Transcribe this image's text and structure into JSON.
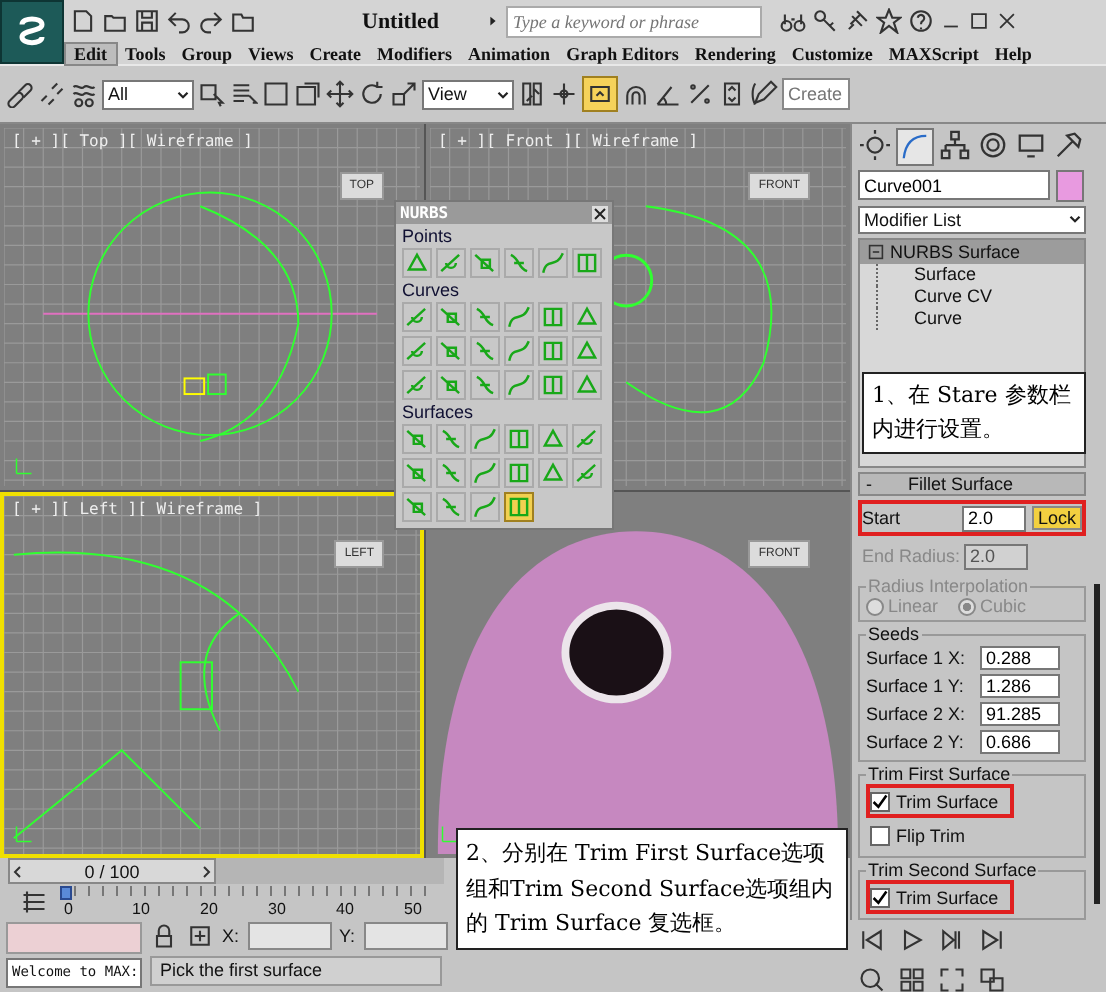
{
  "title_bar": {
    "title": "Untitled",
    "search": {
      "placeholder": "Type a keyword or phrase"
    }
  },
  "menu": [
    {
      "label": "Edit",
      "selected": true
    },
    {
      "label": "Tools",
      "selected": false
    },
    {
      "label": "Group",
      "selected": false
    },
    {
      "label": "Views",
      "selected": false
    },
    {
      "label": "Create",
      "selected": false
    },
    {
      "label": "Modifiers",
      "selected": false
    },
    {
      "label": "Animation",
      "selected": false
    },
    {
      "label": "Graph Editors",
      "selected": false
    },
    {
      "label": "Rendering",
      "selected": false
    },
    {
      "label": "Customize",
      "selected": false
    },
    {
      "label": "MAXScript",
      "selected": false
    },
    {
      "label": "Help",
      "selected": false
    }
  ],
  "toolbar": {
    "selection_filter": "All",
    "reference_coord": "View",
    "named_selection": {
      "placeholder": "Create"
    }
  },
  "viewports": [
    {
      "kind": "top",
      "label": "[ + ][ Top ][ Wireframe ]",
      "cube_label": "TOP",
      "active": false
    },
    {
      "kind": "front",
      "label": "[ + ][ Front ][ Wireframe ]",
      "cube_label": "FRONT",
      "active": false
    },
    {
      "kind": "left",
      "label": "[ + ][ Left ][ Wireframe ]",
      "cube_label": "LEFT",
      "active": true
    },
    {
      "kind": "perspective",
      "cube_label": "FRONT",
      "active": false
    }
  ],
  "nurbs_toolbox": {
    "title": "NURBS",
    "sections": [
      {
        "label": "Points",
        "tools": [
          {
            "selected": false
          },
          {
            "selected": false
          },
          {
            "selected": false
          },
          {
            "selected": false
          },
          {
            "selected": false
          },
          {
            "selected": false
          }
        ]
      },
      {
        "label": "Curves",
        "tools": [
          {
            "selected": false
          },
          {
            "selected": false
          },
          {
            "selected": false
          },
          {
            "selected": false
          },
          {
            "selected": false
          },
          {
            "selected": false
          },
          {
            "selected": false
          },
          {
            "selected": false
          },
          {
            "selected": false
          },
          {
            "selected": false
          },
          {
            "selected": false
          },
          {
            "selected": false
          },
          {
            "selected": false
          },
          {
            "selected": false
          },
          {
            "selected": false
          },
          {
            "selected": false
          },
          {
            "selected": false
          },
          {
            "selected": false
          }
        ]
      },
      {
        "label": "Surfaces",
        "tools": [
          {
            "selected": false
          },
          {
            "selected": false
          },
          {
            "selected": false
          },
          {
            "selected": false
          },
          {
            "selected": false
          },
          {
            "selected": false
          },
          {
            "selected": false
          },
          {
            "selected": false
          },
          {
            "selected": false
          },
          {
            "selected": false
          },
          {
            "selected": false
          },
          {
            "selected": false
          },
          {
            "selected": false
          },
          {
            "selected": false
          },
          {
            "selected": false
          },
          {
            "selected": true
          }
        ]
      }
    ]
  },
  "command_panel": {
    "tabs": [
      {
        "selected": false
      },
      {
        "selected": true
      },
      {
        "selected": false
      },
      {
        "selected": false
      },
      {
        "selected": false
      },
      {
        "selected": false
      }
    ],
    "object_name": "Curve001",
    "modifier_list": "Modifier List",
    "stack": [
      {
        "label": "NURBS Surface",
        "selected": true,
        "expanded": true,
        "children": [
          {
            "label": "Surface"
          },
          {
            "label": "Curve CV"
          },
          {
            "label": "Curve"
          }
        ]
      }
    ],
    "rollout": {
      "toggle": "-",
      "title": "Fillet Surface",
      "start": {
        "label": "Start",
        "value": "2.0",
        "highlighted": true
      },
      "lock": {
        "label": "Lock",
        "on": true
      },
      "end_radius": {
        "label": "End Radius:",
        "value": "2.0",
        "disabled": true
      },
      "radius_interpolation": {
        "title": "Radius Interpolation",
        "disabled": true,
        "options": [
          {
            "label": "Linear",
            "selected": false
          },
          {
            "label": "Cubic",
            "selected": true
          }
        ]
      },
      "seeds": {
        "title": "Seeds",
        "fields": [
          {
            "label": "Surface 1 X:",
            "value": "0.288"
          },
          {
            "label": "Surface 1 Y:",
            "value": "1.286"
          },
          {
            "label": "Surface 2 X:",
            "value": "91.285"
          },
          {
            "label": "Surface 2 Y:",
            "value": "0.686"
          }
        ]
      },
      "trim_groups": [
        {
          "title": "Trim First Surface",
          "options": [
            {
              "label": "Trim Surface",
              "checked": true,
              "highlighted": true
            },
            {
              "label": "Flip Trim",
              "checked": false,
              "highlighted": false
            }
          ]
        },
        {
          "title": "Trim Second Surface",
          "options": [
            {
              "label": "Trim Surface",
              "checked": true,
              "highlighted": true
            }
          ]
        }
      ]
    }
  },
  "timeline": {
    "frame": "0 / 100",
    "level": 0,
    "ticks": [
      "0",
      "10",
      "20",
      "30",
      "40",
      "50"
    ]
  },
  "status": {
    "maxscript": "Welcome to MAX:",
    "prompt": "Pick the first surface",
    "x_label": "X:",
    "y_label": "Y:"
  },
  "annotations": [
    {
      "text": "1、在 Stare 参数栏内进行设置。"
    },
    {
      "text": "2、分别在 Trim First Surface选项组和Trim Second Surface选项组内的 Trim Surface 复选框。"
    }
  ]
}
